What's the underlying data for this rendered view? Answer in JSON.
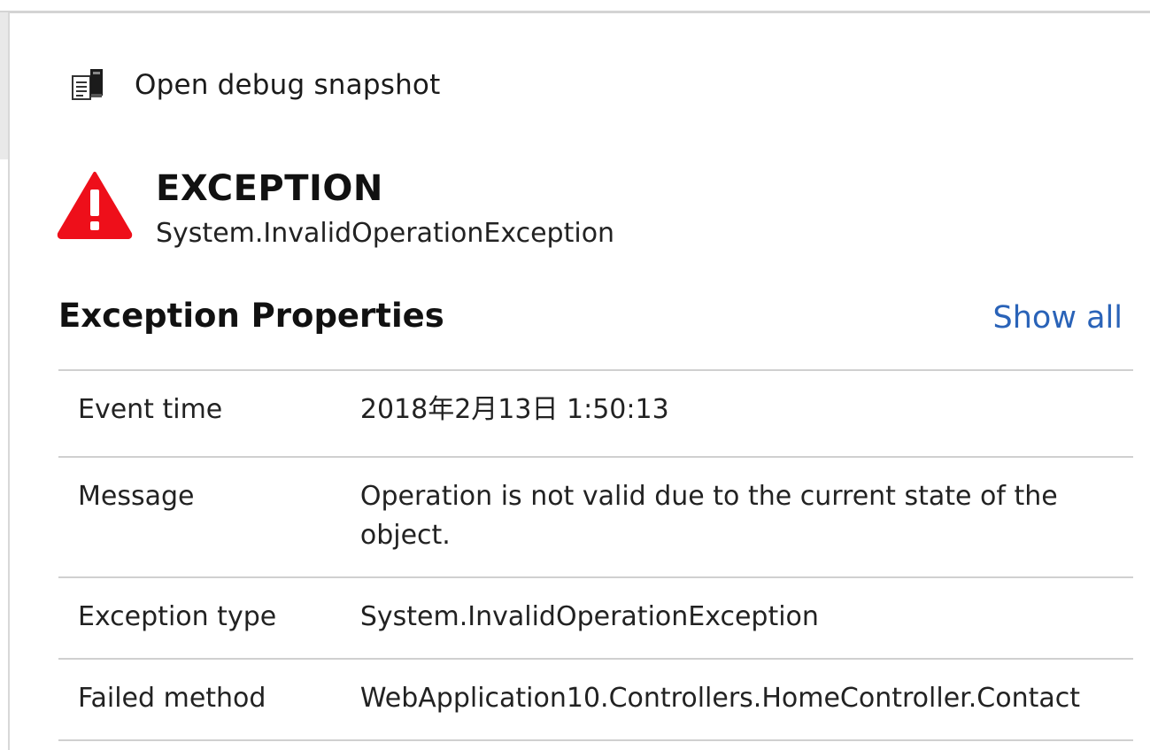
{
  "snapshot": {
    "label": "Open debug snapshot",
    "icon": "debug-snapshot-icon"
  },
  "exception": {
    "title": "EXCEPTION",
    "type": "System.InvalidOperationException",
    "icon": "warning-triangle-icon",
    "icon_color": "#e81123"
  },
  "properties": {
    "title": "Exception Properties",
    "show_all_label": "Show all",
    "link_color": "#2a63b8",
    "rows": [
      {
        "key": "Event time",
        "value": "2018年2月13日 1:50:13"
      },
      {
        "key": "Message",
        "value": "Operation is not valid due to the current state of the object."
      },
      {
        "key": "Exception type",
        "value": "System.InvalidOperationException"
      },
      {
        "key": "Failed method",
        "value": "WebApplication10.Controllers.HomeController.Contact"
      }
    ]
  }
}
